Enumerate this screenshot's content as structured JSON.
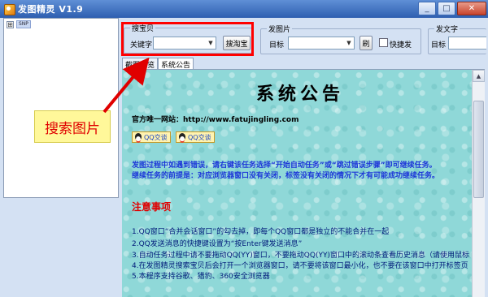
{
  "window": {
    "title": "发图精灵 V1.9",
    "minimize_glyph": "_",
    "maximize_glyph": "□",
    "close_glyph": "✕"
  },
  "tree": {
    "expander": "⊞",
    "root_label": "SNP"
  },
  "search_group": {
    "title": "搜宝贝",
    "keyword_label": "关键字",
    "keyword_value": "",
    "search_button": "搜淘宝"
  },
  "post_image_group": {
    "title": "发图片",
    "target_label": "目标",
    "target_value": "",
    "refresh_button": "刷",
    "quick_post_label": "快捷发"
  },
  "post_text_group": {
    "title": "发文字",
    "target_label": "目标"
  },
  "tabs": [
    {
      "label": "截图预览",
      "active": false
    },
    {
      "label": "系统公告",
      "active": true
    }
  ],
  "notice": {
    "title": "系统公告",
    "site_line": "官方唯一网站：http://www.fatujingling.com",
    "qq_buttons": [
      "QQ交谈",
      "QQ交谈"
    ],
    "paragraph": [
      "发图过程中如遇到错误，请右键该任务选择“开始自动任务”或“跳过错误步骤”即可继续任务。",
      "继续任务的前提是：对应浏览器窗口没有关闭，标签没有关闭的情况下才有可能成功继续任务。"
    ],
    "caution_title": "注意事项",
    "rules": [
      "1.QQ窗口“合并会话窗口”的勾去掉，即每个QQ窗口都是独立的不能合并在一起",
      "2.QQ发送消息的快捷键设置为“按Enter键发送消息”",
      "3.自动任务过程中请不要拖动QQ(YY)窗口，不要拖动QQ(YY)窗口中的滚动条查看历史消息（请使用鼠标",
      "4.在发图精灵搜索宝贝后会打开一个浏览器窗口，请不要将该窗口最小化，也不要在该窗口中打开标签页",
      "5.本程序支持谷歌、猎豹、360安全浏览器"
    ]
  },
  "annotation": {
    "label": "搜索图片",
    "color": "#e00000"
  },
  "colors": {
    "titlebar": "#2e5fb0",
    "content_bg": "#8fd8d8",
    "highlight": "#ff0000"
  }
}
